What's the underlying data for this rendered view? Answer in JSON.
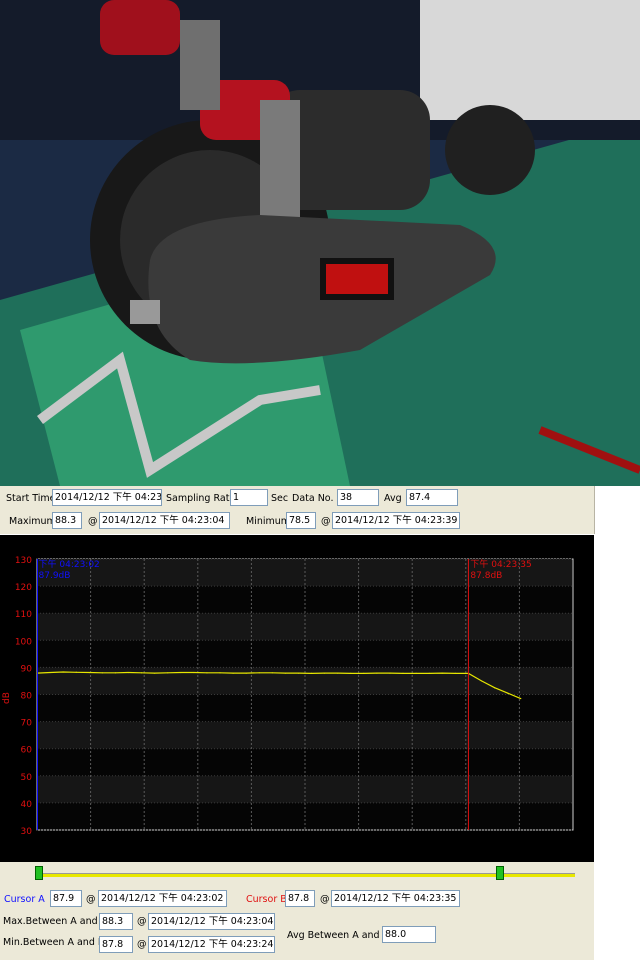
{
  "header": {
    "start_time_label": "Start Time",
    "start_time_value": "2014/12/12 下午 04:23:0",
    "sampling_rate_label": "Sampling Rate",
    "sampling_rate_value": "1",
    "sec_label": "Sec",
    "data_no_label": "Data No.",
    "data_no_value": "38",
    "avg_label": "Avg",
    "avg_value": "87.4",
    "maximum_label": "Maximum",
    "maximum_value": "88.3",
    "max_at": "@",
    "maximum_time": "2014/12/12 下午 04:23:04",
    "minimum_label": "Minimum",
    "minimum_value": "78.5",
    "min_at": "@",
    "minimum_time": "2014/12/12 下午 04:23:39"
  },
  "cursors": {
    "a_label": "Cursor A",
    "a_value": "87.9",
    "a_at": "@",
    "a_time": "2014/12/12 下午 04:23:02",
    "b_label": "Cursor B",
    "b_value": "87.8",
    "b_at": "@",
    "b_time": "2014/12/12 下午 04:23:35",
    "max_ab_label": "Max.Between A and B",
    "max_ab_value": "88.3",
    "max_ab_at": "@",
    "max_ab_time": "2014/12/12 下午 04:23:04",
    "min_ab_label": "Min.Between A and B",
    "min_ab_value": "87.8",
    "min_ab_at": "@",
    "min_ab_time": "2014/12/12 下午 04:23:24",
    "avg_ab_label": "Avg Between A and B",
    "avg_ab_value": "88.0"
  },
  "colors": {
    "cursor_a": "#1010ff",
    "cursor_b": "#e01010",
    "trace": "#e6e600",
    "axis_text": "#e01010",
    "panel": "#ece9d8"
  },
  "chart_data": {
    "type": "line",
    "ylabel": "dB",
    "ylim": [
      30,
      130
    ],
    "yticks": [
      30,
      40,
      50,
      60,
      70,
      80,
      90,
      100,
      110,
      120,
      130
    ],
    "grid": true,
    "cursor_a": {
      "label_time": "下午 04:23:02",
      "label_value": "87.9dB",
      "index": 0
    },
    "cursor_b": {
      "label_time": "下午 04:23:35",
      "label_value": "87.8dB",
      "index": 33
    },
    "x": [
      0,
      1,
      2,
      3,
      4,
      5,
      6,
      7,
      8,
      9,
      10,
      11,
      12,
      13,
      14,
      15,
      16,
      17,
      18,
      19,
      20,
      21,
      22,
      23,
      24,
      25,
      26,
      27,
      28,
      29,
      30,
      31,
      32,
      33,
      34,
      35,
      36,
      37
    ],
    "series": [
      {
        "values": [
          87.9,
          88.1,
          88.3,
          88.2,
          88.1,
          88.0,
          88.0,
          88.1,
          88.0,
          87.9,
          88.0,
          88.1,
          88.1,
          88.0,
          88.0,
          87.9,
          87.9,
          88.0,
          88.0,
          87.9,
          87.9,
          87.8,
          87.9,
          87.9,
          87.8,
          87.8,
          87.9,
          87.9,
          87.8,
          87.8,
          87.8,
          87.9,
          87.8,
          87.8,
          85.0,
          82.5,
          80.5,
          78.5
        ]
      }
    ]
  }
}
